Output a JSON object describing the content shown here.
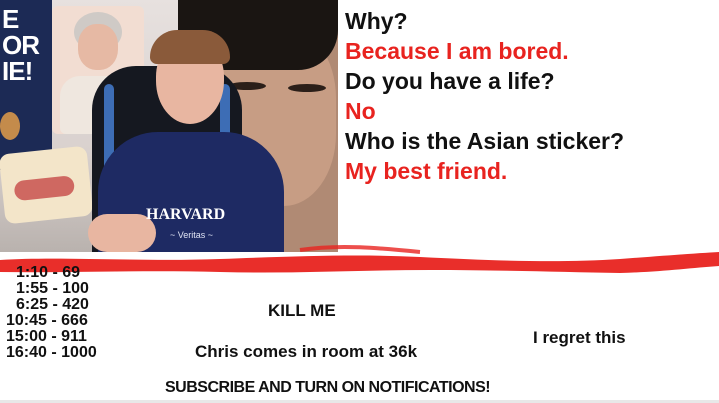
{
  "video": {
    "poster_text": [
      "E",
      "OR",
      "IE!"
    ],
    "shirt_text": "HARVARD",
    "shirt_subtext": "~ Veritas ~"
  },
  "dialogue": [
    {
      "text": "Why?",
      "kind": "question"
    },
    {
      "text": "Because I am bored.",
      "kind": "answer"
    },
    {
      "text": "Do you have a life?",
      "kind": "question"
    },
    {
      "text": "No",
      "kind": "answer"
    },
    {
      "text": "Who is the Asian sticker?",
      "kind": "question"
    },
    {
      "text": "My best friend.",
      "kind": "answer"
    }
  ],
  "timestamps": [
    "1:10 - 69",
    "1:55 - 100",
    "6:25 - 420",
    "10:45 - 666",
    "15:00 - 911",
    "16:40 - 1000"
  ],
  "notes": {
    "kill_me": "KILL ME",
    "i_regret": "I regret this",
    "chris": "Chris comes in room at 36k",
    "subscribe": "SUBSCRIBE AND TURN ON NOTIFICATIONS!"
  },
  "colors": {
    "accent_red": "#e8231f",
    "text_dark": "#111111",
    "shirt_navy": "#1e2a63"
  }
}
